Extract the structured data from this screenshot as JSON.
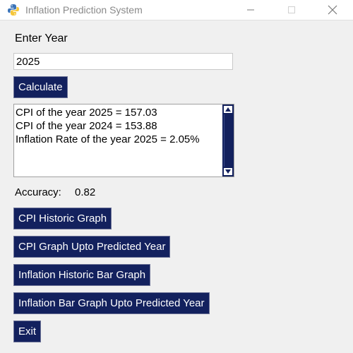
{
  "window": {
    "title": "Inflation Prediction System",
    "icon": "python-logo-icon",
    "controls": [
      "minimize-icon",
      "maximize-icon",
      "close-icon"
    ]
  },
  "form": {
    "year_label": "Enter Year",
    "year_value": "2025",
    "calculate_label": "Calculate"
  },
  "output": {
    "lines": [
      "CPI of the year 2025 = 157.03",
      "CPI of the year 2024 = 153.88",
      "Inflation Rate of the year 2025 = 2.05%"
    ]
  },
  "accuracy": {
    "label": "Accuracy:",
    "value": "0.82"
  },
  "buttons": {
    "cpi_historic": "CPI Historic Graph",
    "cpi_predicted": "CPI Graph Upto Predicted Year",
    "inflation_historic": "Inflation Historic Bar Graph",
    "inflation_predicted": "Inflation Bar Graph Upto Predicted Year",
    "exit": "Exit"
  },
  "colors": {
    "button_bg": "#13215e",
    "button_text": "#ffffff",
    "window_bg": "#f0f0f0"
  }
}
